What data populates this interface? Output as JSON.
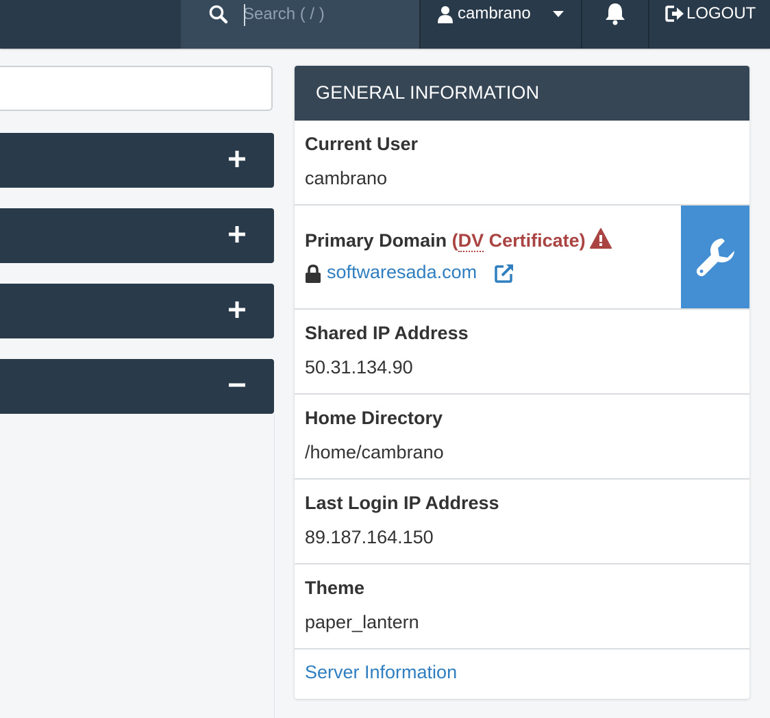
{
  "topbar": {
    "search": {
      "placeholder": "Search ( / )",
      "icon": "search-icon"
    },
    "user": {
      "name": "cambrano",
      "icon": "user-icon"
    },
    "notifications_icon": "bell-icon",
    "logout_label": "LOGOUT"
  },
  "left_panels": [
    {
      "toggle": "plus-icon"
    },
    {
      "toggle": "plus-icon"
    },
    {
      "toggle": "plus-icon"
    },
    {
      "toggle": "minus-icon"
    }
  ],
  "general_info": {
    "title": "GENERAL INFORMATION",
    "current_user": {
      "label": "Current User",
      "value": "cambrano"
    },
    "primary_domain": {
      "label": "Primary Domain",
      "cert_open": "(",
      "cert_type": "DV",
      "cert_rest": " Certificate)",
      "domain": "softwaresada.com"
    },
    "shared_ip": {
      "label": "Shared IP Address",
      "value": "50.31.134.90"
    },
    "home_dir": {
      "label": "Home Directory",
      "value": "/home/cambrano"
    },
    "last_login_ip": {
      "label": "Last Login IP Address",
      "value": "89.187.164.150"
    },
    "theme": {
      "label": "Theme",
      "value": "paper_lantern"
    },
    "server_info_link": "Server Information"
  },
  "colors": {
    "topbar": "#293a4a",
    "card_header": "#364655",
    "link": "#2f7ec0",
    "warning": "#a94442",
    "wrench_button": "#448fd3"
  }
}
